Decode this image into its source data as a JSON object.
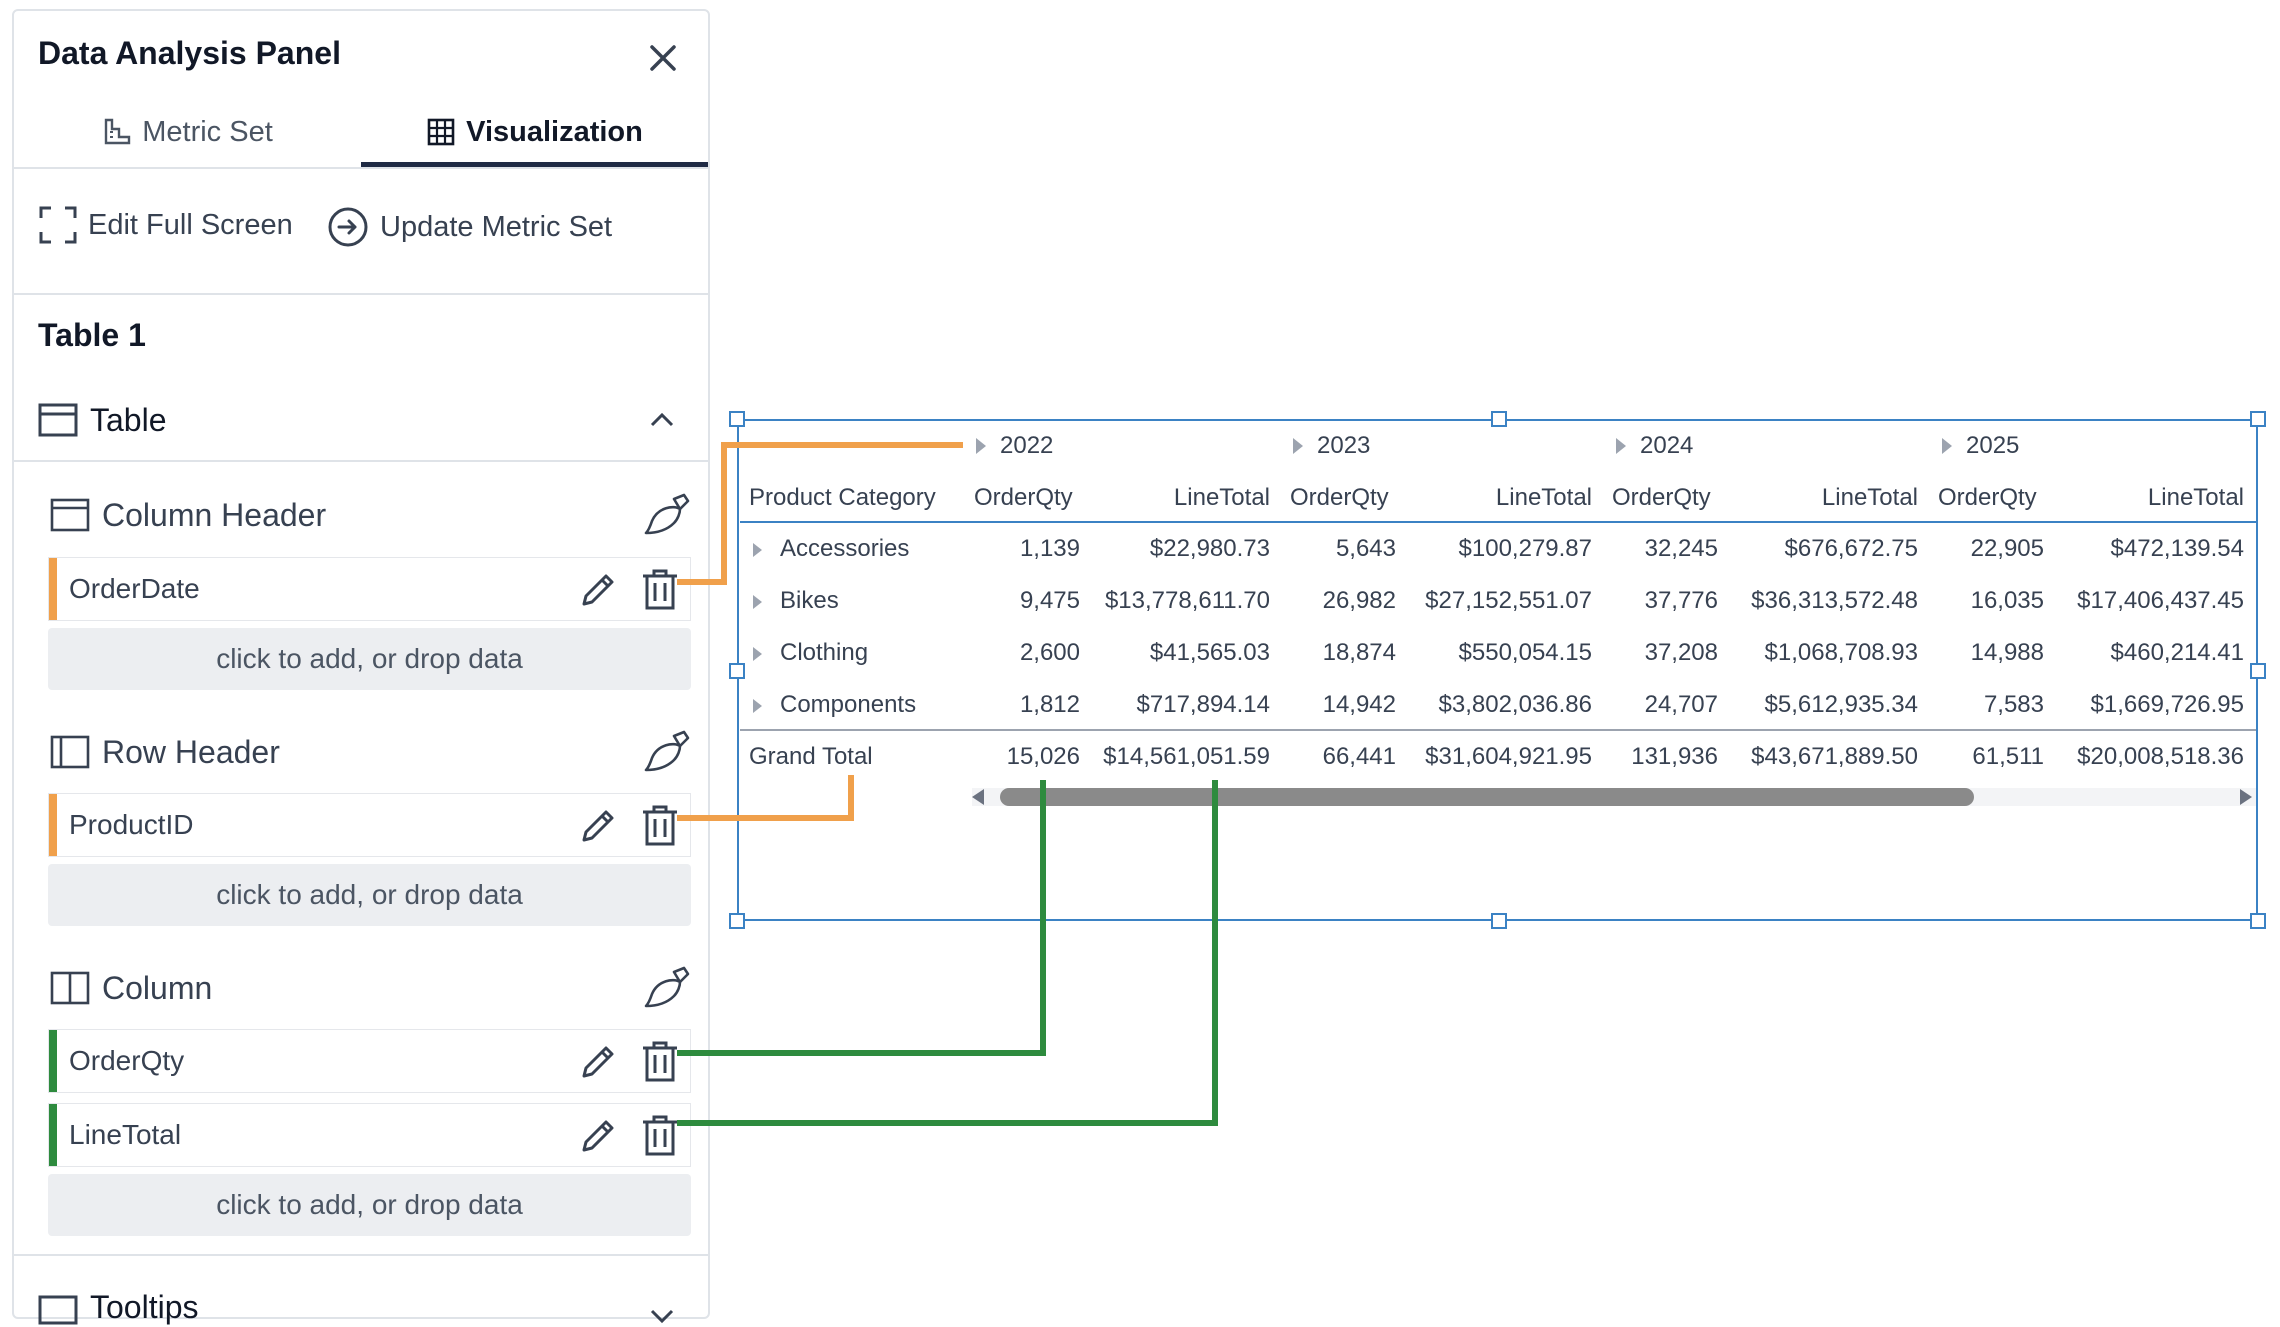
{
  "panel": {
    "title": "Data Analysis Panel",
    "tabs": [
      {
        "label": "Metric Set",
        "icon": "metric-set-icon",
        "active": false
      },
      {
        "label": "Visualization",
        "icon": "grid-icon",
        "active": true
      }
    ],
    "actions": [
      {
        "label": "Edit Full Screen",
        "icon": "fullscreen-icon"
      },
      {
        "label": "Update Metric Set",
        "icon": "arrow-circle-icon"
      }
    ],
    "section_title": "Table 1",
    "group": {
      "label": "Table",
      "icon": "table-icon",
      "expanded": true
    },
    "column_header": {
      "label": "Column Header",
      "fields": [
        {
          "label": "OrderDate",
          "color": "#f0a04b"
        }
      ],
      "dropzone": "click to add, or drop data"
    },
    "row_header": {
      "label": "Row Header",
      "fields": [
        {
          "label": "ProductID",
          "color": "#f0a04b"
        }
      ],
      "dropzone": "click to add, or drop data"
    },
    "column": {
      "label": "Column",
      "fields": [
        {
          "label": "OrderQty",
          "color": "#2e8b3e"
        },
        {
          "label": "LineTotal",
          "color": "#2e8b3e"
        }
      ],
      "dropzone": "click to add, or drop data"
    },
    "tooltips_label": "Tooltips"
  },
  "table": {
    "years": [
      "2022",
      "2023",
      "2024",
      "2025"
    ],
    "row_header_label": "Product Category",
    "measure_labels": [
      "OrderQty",
      "LineTotal"
    ],
    "rows": [
      {
        "label": "Accessories",
        "values": [
          "1,139",
          "$22,980.73",
          "5,643",
          "$100,279.87",
          "32,245",
          "$676,672.75",
          "22,905",
          "$472,139.54"
        ]
      },
      {
        "label": "Bikes",
        "values": [
          "9,475",
          "$13,778,611.70",
          "26,982",
          "$27,152,551.07",
          "37,776",
          "$36,313,572.48",
          "16,035",
          "$17,406,437.45"
        ]
      },
      {
        "label": "Clothing",
        "values": [
          "2,600",
          "$41,565.03",
          "18,874",
          "$550,054.15",
          "37,208",
          "$1,068,708.93",
          "14,988",
          "$460,214.41"
        ]
      },
      {
        "label": "Components",
        "values": [
          "1,812",
          "$717,894.14",
          "14,942",
          "$3,802,036.86",
          "24,707",
          "$5,612,935.34",
          "7,583",
          "$1,669,726.95"
        ]
      }
    ],
    "total": {
      "label": "Grand Total",
      "values": [
        "15,026",
        "$14,561,051.59",
        "66,441",
        "$31,604,921.95",
        "131,936",
        "$43,671,889.50",
        "61,511",
        "$20,008,518.36"
      ]
    }
  },
  "colors": {
    "accent_orange": "#f0a04b",
    "accent_green": "#2e8b3e",
    "selection_blue": "#3b82c4",
    "active_tab_underline": "#1f2a44"
  }
}
